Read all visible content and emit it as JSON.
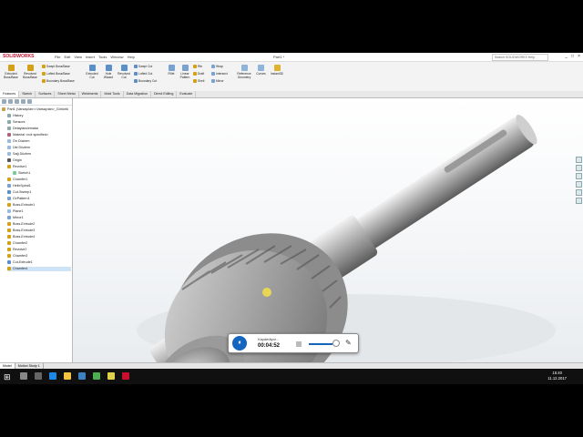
{
  "app": {
    "brand": "SOLIDWORKS",
    "document": "Part1 *",
    "search_placeholder": "Search SOLIDWORKS Help",
    "window_controls": [
      "_",
      "□",
      "×"
    ]
  },
  "menus": [
    "File",
    "Edit",
    "View",
    "Insert",
    "Tools",
    "Window",
    "Help"
  ],
  "ribbon": {
    "extruded_boss": "Extruded Boss/Base",
    "revolved_boss": "Revolved Boss/Base",
    "swept_boss": "Swept Boss/Base",
    "lofted_boss": "Lofted Boss/Base",
    "boundary_boss": "Boundary Boss/Base",
    "extruded_cut": "Extruded Cut",
    "hole_wizard": "Hole Wizard",
    "revolved_cut": "Revolved Cut",
    "swept_cut": "Swept Cut",
    "lofted_cut": "Lofted Cut",
    "boundary_cut": "Boundary Cut",
    "fillet": "Fillet",
    "linear_pattern": "Linear Pattern",
    "rib": "Rib",
    "draft": "Draft",
    "shell": "Shell",
    "wrap": "Wrap",
    "intersect": "Intersect",
    "mirror": "Mirror",
    "reference_geometry": "Reference Geometry",
    "curves": "Curves",
    "instant3d": "Instant3D"
  },
  "tabs": [
    "Features",
    "Sketch",
    "Surfaces",
    "Sheet Metal",
    "Weldments",
    "Mold Tools",
    "Data Migration",
    "Direct Editing",
    "Evaluate"
  ],
  "tree": {
    "root": "Part1 (Varsayılan<<Varsayılan>_Görüntü",
    "items": [
      "History",
      "Sensors",
      "Detaylandırmalar",
      "Material <not specified>",
      "Ön Düzlem",
      "Üst Düzlem",
      "Sağ Düzlem",
      "Origin",
      "Revolve1",
      "Sketch1",
      "Chamfer1",
      "HelixSpiral1",
      "Cut-Sweep1",
      "CirPattern1",
      "Boss-Extrude1",
      "Plane1",
      "Mirror1",
      "Boss-Extrude2",
      "Boss-Extrude3",
      "Boss-Extrude4",
      "Chamfer2",
      "Revolve2",
      "Chamfer3",
      "Cut-Extrude1",
      "Chamfer4"
    ]
  },
  "bottom_tabs": [
    "Model",
    "Motion Study 1"
  ],
  "status": {
    "left": "SOLIDWORKS 2016 x64 Edition",
    "units": "MMGS"
  },
  "recorder": {
    "label": "Kaydediyor...",
    "time": "00:04:52",
    "pause_icon": "⏸"
  },
  "clock": {
    "time": "15:40",
    "date": "11.12.2017"
  },
  "colors": {
    "brand": "#c8102e",
    "accent": "#1565c0",
    "selection": "#cfe3f7"
  }
}
